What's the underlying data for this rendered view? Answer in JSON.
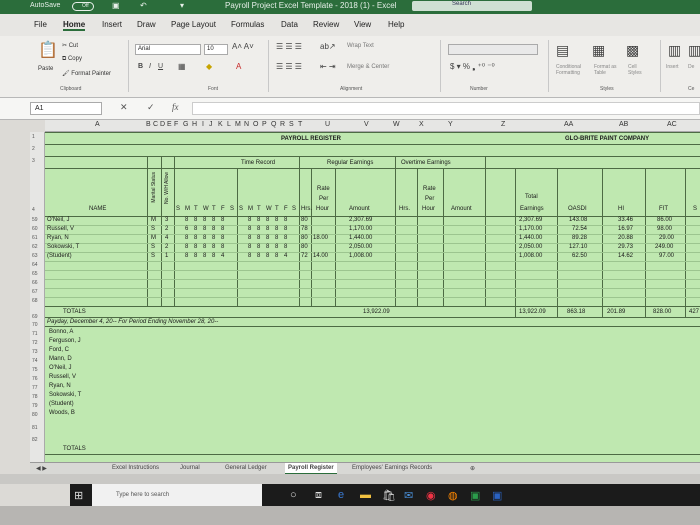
{
  "titlebar": {
    "autosave": "AutoSave",
    "toggle": "Off",
    "title": "Payroll Project Excel Template - 2018 (1) - Excel",
    "search": "Search"
  },
  "menu": [
    "File",
    "Home",
    "Insert",
    "Draw",
    "Page Layout",
    "Formulas",
    "Data",
    "Review",
    "View",
    "Help"
  ],
  "ribbon": {
    "cut": "Cut",
    "copy": "Copy",
    "format_painter": "Format Painter",
    "paste": "Paste",
    "font_name": "Arial",
    "font_size": "10",
    "wrap_text": "Wrap Text",
    "merge_center": "Merge & Center",
    "conditional_formatting": "Conditional Formatting",
    "format_as_table": "Format as Table",
    "cell_styles": "Cell Styles",
    "insert": "Insert",
    "delete": "De",
    "groups": {
      "clipboard": "Clipboard",
      "font": "Font",
      "alignment": "Alignment",
      "number": "Number",
      "styles": "Styles",
      "cells": "Ce"
    }
  },
  "formula_bar": {
    "name_box": "A1",
    "fx": "fx",
    "value": ""
  },
  "columns": [
    "A",
    "B",
    "C",
    "D",
    "E",
    "F",
    "G",
    "H",
    "I",
    "J",
    "K",
    "L",
    "M",
    "N",
    "O",
    "P",
    "Q",
    "R",
    "S",
    "T",
    "U",
    "V",
    "W",
    "X",
    "Y",
    "Z",
    "AA",
    "AB",
    "AC"
  ],
  "rows": [
    "1",
    "2",
    "3",
    "4",
    "59",
    "60",
    "61",
    "62",
    "63",
    "64",
    "65",
    "66",
    "67",
    "68",
    "69",
    "70",
    "71",
    "72",
    "73",
    "74",
    "75",
    "76",
    "77",
    "78",
    "79",
    "80",
    "81",
    "82"
  ],
  "sheet": {
    "title": "PAYROLL REGISTER",
    "company": "GLO-BRITE PAINT COMPANY",
    "time_record": "Time Record",
    "regular_earnings": "Regular Earnings",
    "overtime_earnings": "Overtime Earnings",
    "name_header": "NAME",
    "marital_status": "Marital Status",
    "withholding": "No. W/H Allow",
    "days": [
      "S",
      "M",
      "T",
      "W",
      "T",
      "F",
      "S",
      "S",
      "M",
      "T",
      "W",
      "T",
      "F",
      "S"
    ],
    "hrs": "Hrs.",
    "rate_per_hour": [
      "Rate",
      "Per",
      "Hour"
    ],
    "amount": "Amount",
    "total_earnings": [
      "Total",
      "Earnings"
    ],
    "oasdi": "OASDI",
    "hi": "HI",
    "fit": "FIT",
    "employees": [
      {
        "name": "O'Neil, J",
        "ms": "M",
        "wh": "3",
        "wk1": [
          "8",
          "8",
          "8",
          "8",
          "8"
        ],
        "wk2": [
          "8",
          "8",
          "8",
          "8",
          "8"
        ],
        "hrs": "80",
        "rate": "",
        "amount": "2,307.69",
        "total": "2,307.69",
        "oasdi": "143.08",
        "hi": "33.46",
        "fit": "86.00"
      },
      {
        "name": "Russell, V",
        "ms": "S",
        "wh": "2",
        "wk1": [
          "6",
          "8",
          "8",
          "8",
          "8"
        ],
        "wk2": [
          "8",
          "8",
          "8",
          "8",
          "8"
        ],
        "hrs": "78",
        "rate": "",
        "amount": "1,170.00",
        "total": "1,170.00",
        "oasdi": "72.54",
        "hi": "16.97",
        "fit": "98.00"
      },
      {
        "name": "Ryan, N",
        "ms": "M",
        "wh": "4",
        "wk1": [
          "8",
          "8",
          "8",
          "8",
          "8"
        ],
        "wk2": [
          "8",
          "8",
          "8",
          "8",
          "8"
        ],
        "hrs": "80",
        "rate": "18.00",
        "amount": "1,440.00",
        "total": "1,440.00",
        "oasdi": "89.28",
        "hi": "20.88",
        "fit": "29.00"
      },
      {
        "name": "Sokowski, T",
        "ms": "S",
        "wh": "2",
        "wk1": [
          "8",
          "8",
          "8",
          "8",
          "8"
        ],
        "wk2": [
          "8",
          "8",
          "8",
          "8",
          "8"
        ],
        "hrs": "80",
        "rate": "",
        "amount": "2,050.00",
        "total": "2,050.00",
        "oasdi": "127.10",
        "hi": "29.73",
        "fit": "249.00"
      },
      {
        "name": "(Student)",
        "ms": "S",
        "wh": "1",
        "wk1": [
          "8",
          "8",
          "8",
          "8",
          "4"
        ],
        "wk2": [
          "8",
          "8",
          "8",
          "8",
          "4"
        ],
        "hrs": "72",
        "rate": "14.00",
        "amount": "1,008.00",
        "total": "1,008.00",
        "oasdi": "62.50",
        "hi": "14.62",
        "fit": "97.00"
      }
    ],
    "totals_label": "TOTALS",
    "totals": {
      "amount": "13,922.09",
      "total": "13,922.09",
      "oasdi": "863.18",
      "hi": "201.89",
      "fit": "828.00",
      "extra": "427"
    },
    "payday_note": "Payday, December 4, 20-- For Period Ending November 28, 20--",
    "lower_names": [
      "Bonno, A",
      "Ferguson, J",
      "Ford, C",
      "Mann, D",
      "O'Neil, J",
      "Russell, V",
      "Ryan, N",
      "Sokowski, T",
      "(Student)",
      "Woods, B"
    ],
    "lower_totals": "TOTALS"
  },
  "sheet_tabs": [
    "Excel Instructions",
    "Journal",
    "General Ledger",
    "Payroll Register",
    "Employees' Earnings Records"
  ],
  "active_tab": "Payroll Register",
  "taskbar": {
    "search_placeholder": "Type here to search"
  },
  "colors": {
    "excel_green": "#2b6d3b",
    "sheet_fill": "#bfe8b0"
  }
}
